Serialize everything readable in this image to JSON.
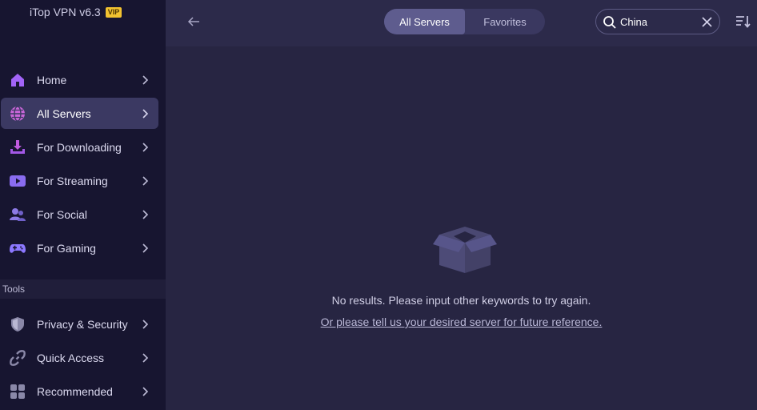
{
  "app": {
    "name": "iTop VPN v6.3",
    "badge": "VIP"
  },
  "sidebar": {
    "items": [
      {
        "label": "Home",
        "icon": "home-icon",
        "color": "#a264f7"
      },
      {
        "label": "All Servers",
        "icon": "globe-icon",
        "color": "#c866d8",
        "active": true
      },
      {
        "label": "For Downloading",
        "icon": "download-icon",
        "color": "#c15ae0"
      },
      {
        "label": "For Streaming",
        "icon": "play-icon",
        "color": "#8a6cf0"
      },
      {
        "label": "For Social",
        "icon": "social-icon",
        "color": "#8d7ae6"
      },
      {
        "label": "For Gaming",
        "icon": "gamepad-icon",
        "color": "#8c78ff"
      }
    ],
    "tools_label": "Tools",
    "tools": [
      {
        "label": "Privacy & Security",
        "icon": "shield-icon"
      },
      {
        "label": "Quick Access",
        "icon": "link-icon"
      },
      {
        "label": "Recommended",
        "icon": "grid-icon"
      }
    ]
  },
  "topbar": {
    "tabs": [
      {
        "label": "All Servers",
        "active": true
      },
      {
        "label": "Favorites"
      }
    ],
    "search": {
      "value": "China"
    }
  },
  "main": {
    "empty_message": "No results. Please input other keywords to try again.",
    "empty_link": "Or please tell us your desired server for future reference."
  },
  "colors": {
    "sidebar_bg": "#171530",
    "main_bg": "#272542",
    "active_item": "#3b3962"
  }
}
